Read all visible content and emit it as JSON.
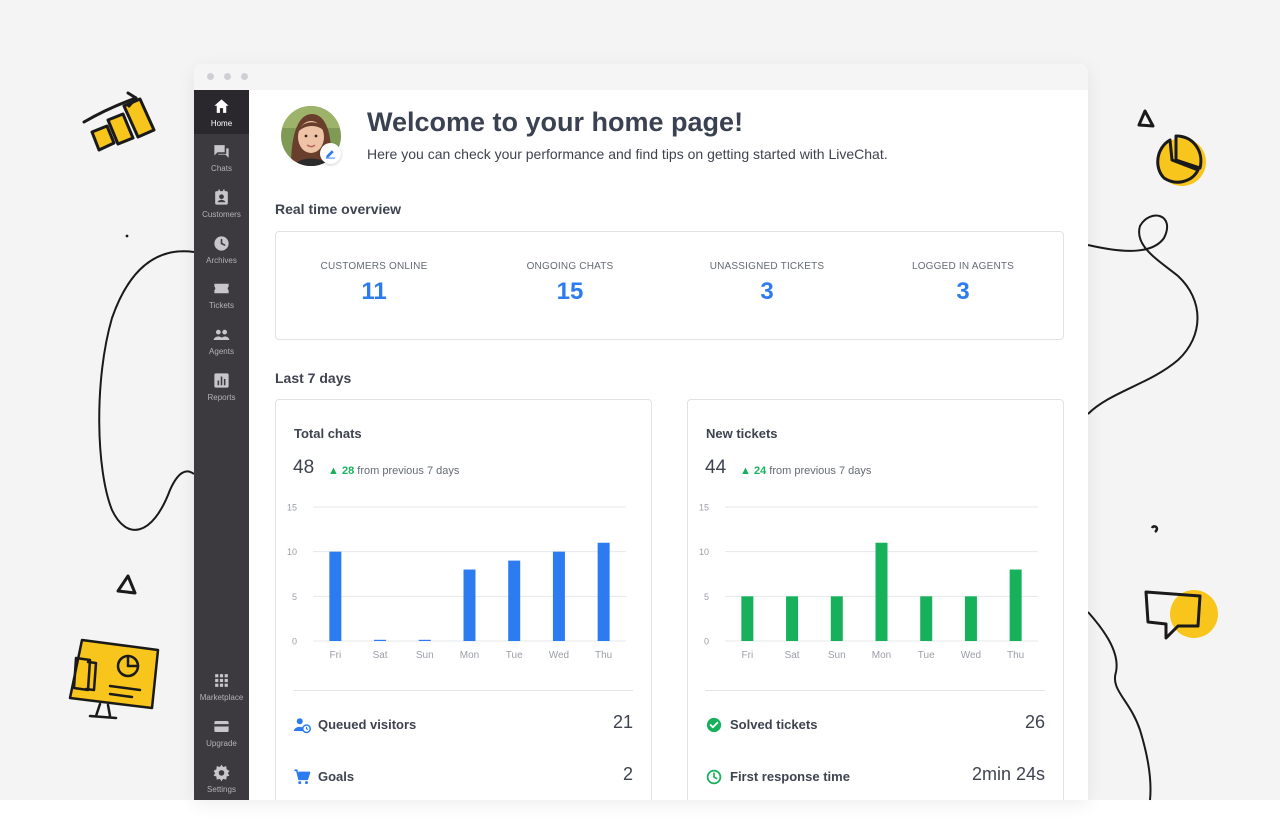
{
  "sidebar": {
    "items": [
      {
        "label": "Home",
        "icon": "home-icon",
        "active": true
      },
      {
        "label": "Chats",
        "icon": "chats-icon"
      },
      {
        "label": "Customers",
        "icon": "customers-icon"
      },
      {
        "label": "Archives",
        "icon": "archives-icon"
      },
      {
        "label": "Tickets",
        "icon": "tickets-icon"
      },
      {
        "label": "Agents",
        "icon": "agents-icon"
      },
      {
        "label": "Reports",
        "icon": "reports-icon"
      }
    ],
    "bottom_items": [
      {
        "label": "Marketplace",
        "icon": "marketplace-icon"
      },
      {
        "label": "Upgrade",
        "icon": "upgrade-icon"
      },
      {
        "label": "Settings",
        "icon": "settings-icon"
      }
    ]
  },
  "header": {
    "title": "Welcome to your home page!",
    "subtitle": "Here you can check your performance and find tips on getting started with LiveChat."
  },
  "realtime": {
    "title": "Real time overview",
    "stats": [
      {
        "label": "CUSTOMERS ONLINE",
        "value": "11"
      },
      {
        "label": "ONGOING CHATS",
        "value": "15"
      },
      {
        "label": "UNASSIGNED TICKETS",
        "value": "3"
      },
      {
        "label": "LOGGED IN AGENTS",
        "value": "3"
      }
    ]
  },
  "last7": {
    "title": "Last 7 days",
    "total_chats": {
      "title": "Total chats",
      "total": "48",
      "delta_value": "28",
      "delta_text": "from previous 7 days",
      "metrics": [
        {
          "label": "Queued visitors",
          "value": "21",
          "icon": "queued-visitors-icon"
        },
        {
          "label": "Goals",
          "value": "2",
          "icon": "cart-icon"
        }
      ]
    },
    "new_tickets": {
      "title": "New tickets",
      "total": "44",
      "delta_value": "24",
      "delta_text": "from previous 7 days",
      "metrics": [
        {
          "label": "Solved tickets",
          "value": "26",
          "icon": "check-circle-icon"
        },
        {
          "label": "First response time",
          "value": "2min 24s",
          "icon": "clock-icon"
        }
      ]
    }
  },
  "colors": {
    "accent_blue": "#2d7bf0",
    "accent_green": "#17b15b",
    "sidebar_bg": "#3c3a3e",
    "doodle_yellow": "#f7c51b"
  },
  "chart_data": [
    {
      "type": "bar",
      "title": "Total chats",
      "categories": [
        "Fri",
        "Sat",
        "Sun",
        "Mon",
        "Tue",
        "Wed",
        "Thu"
      ],
      "values": [
        10,
        0,
        0,
        8,
        9,
        10,
        11
      ],
      "yticks": [
        0,
        5,
        10,
        15
      ],
      "ylim": [
        0,
        15
      ],
      "color": "#2d7bf0",
      "grid": true
    },
    {
      "type": "bar",
      "title": "New tickets",
      "categories": [
        "Fri",
        "Sat",
        "Sun",
        "Mon",
        "Tue",
        "Wed",
        "Thu"
      ],
      "values": [
        5,
        5,
        5,
        11,
        5,
        5,
        8
      ],
      "yticks": [
        0,
        5,
        10,
        15
      ],
      "ylim": [
        0,
        15
      ],
      "color": "#17b15b",
      "grid": true
    }
  ]
}
